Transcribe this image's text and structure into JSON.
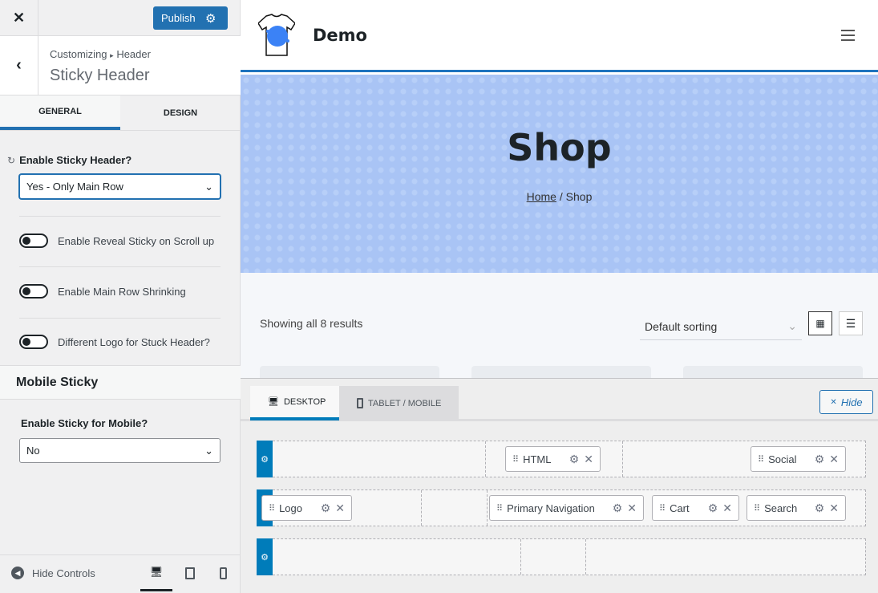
{
  "sidebar": {
    "close_label": "✕",
    "publish_label": "Publish",
    "breadcrumb": {
      "parent": "Customizing",
      "separator": "▸",
      "current": "Header"
    },
    "section_title": "Sticky Header",
    "tabs": [
      {
        "label": "GENERAL",
        "active": true
      },
      {
        "label": "DESIGN",
        "active": false
      }
    ],
    "sticky_header": {
      "label": "Enable Sticky Header?",
      "value": "Yes - Only Main Row"
    },
    "toggles": [
      {
        "label": "Enable Reveal Sticky on Scroll up",
        "on": false
      },
      {
        "label": "Enable Main Row Shrinking",
        "on": false
      },
      {
        "label": "Different Logo for Stuck Header?",
        "on": false
      }
    ],
    "mobile_section": "Mobile Sticky",
    "mobile_sticky": {
      "label": "Enable Sticky for Mobile?",
      "value": "No"
    },
    "hide_controls": "Hide Controls"
  },
  "preview": {
    "site_title": "Demo",
    "page_title": "Shop",
    "breadcrumb_home": "Home",
    "breadcrumb_rest": " / Shop",
    "results": "Showing all 8 results",
    "sorting": "Default sorting"
  },
  "builder": {
    "tabs": [
      {
        "label": "DESKTOP",
        "active": true
      },
      {
        "label": "TABLET / MOBILE",
        "active": false
      }
    ],
    "hide_label": "Hide",
    "rows": [
      {
        "items": [
          "HTML",
          "Social"
        ]
      },
      {
        "items": [
          "Logo",
          "Primary Navigation",
          "Cart",
          "Search"
        ]
      },
      {
        "items": []
      }
    ]
  },
  "colors": {
    "accent": "#2271b1",
    "header_border": "#1e73be",
    "hero_bg": "#a9c4f5",
    "logo_splash": "#3b82f6"
  }
}
